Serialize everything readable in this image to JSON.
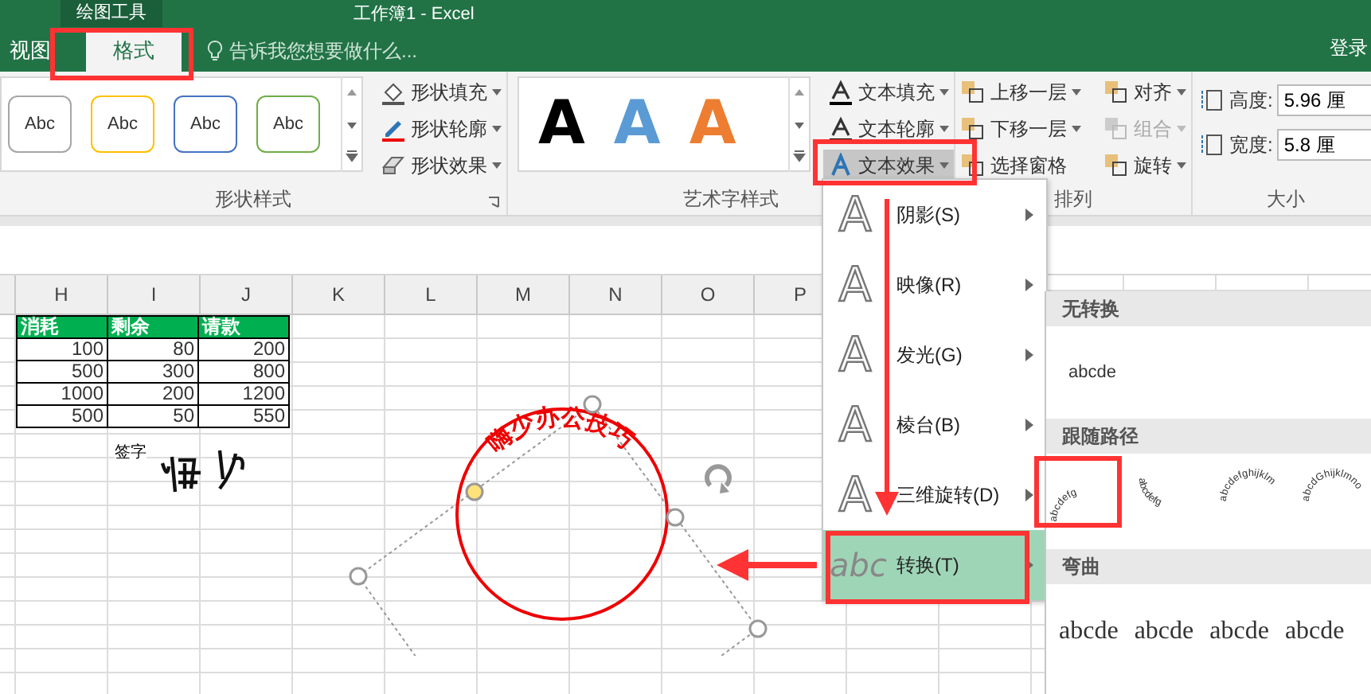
{
  "title_bar": {
    "context_tab": "绘图工具",
    "title": "工作簿1 - Excel"
  },
  "tabs": [
    {
      "label": "视图",
      "selected": false
    },
    {
      "label": "格式",
      "selected": true
    }
  ],
  "tell_me": {
    "placeholder": "告诉我您想要做什么..."
  },
  "sign_in": "登录",
  "ribbon": {
    "shape_styles": {
      "group_label": "形状样式",
      "samples": [
        {
          "label": "Abc",
          "color": "#a6a6a6"
        },
        {
          "label": "Abc",
          "color": "#ffc000"
        },
        {
          "label": "Abc",
          "color": "#4472c4"
        },
        {
          "label": "Abc",
          "color": "#70ad47"
        }
      ],
      "commands": [
        "形状填充",
        "形状轮廓",
        "形状效果"
      ]
    },
    "wordart_styles": {
      "group_label": "艺术字样式",
      "samples": [
        {
          "label": "A",
          "color": "#000000"
        },
        {
          "label": "A",
          "color": "#5b9bd5"
        },
        {
          "label": "A",
          "color": "#ed7d31"
        }
      ],
      "commands": [
        {
          "label": "文本填充",
          "selected": false
        },
        {
          "label": "文本轮廓",
          "selected": false
        },
        {
          "label": "文本效果",
          "selected": true
        }
      ]
    },
    "arrange": {
      "group_label": "排列",
      "commands": [
        {
          "label": "上移一层",
          "disabled": false
        },
        {
          "label": "下移一层",
          "disabled": false
        },
        {
          "label": "选择窗格",
          "disabled": false
        },
        {
          "label": "对齐",
          "disabled": false
        },
        {
          "label": "组合",
          "disabled": true
        },
        {
          "label": "旋转",
          "disabled": false
        }
      ]
    },
    "size": {
      "group_label": "大小",
      "fields": [
        {
          "label": "高度:",
          "value": "5.96 厘"
        },
        {
          "label": "宽度:",
          "value": "5.8 厘"
        }
      ]
    }
  },
  "sheet": {
    "columns": [
      "H",
      "I",
      "J",
      "K",
      "L",
      "M",
      "N",
      "O",
      "P"
    ],
    "table": {
      "header": [
        "消耗",
        "剩余",
        "请款"
      ],
      "rows": [
        [
          "100",
          "80",
          "200"
        ],
        [
          "500",
          "300",
          "800"
        ],
        [
          "1000",
          "200",
          "1200"
        ],
        [
          "500",
          "50",
          "550"
        ]
      ]
    },
    "signature_label": "签字",
    "stamp_text": "嗨少办公技巧"
  },
  "text_effects_menu": {
    "items": [
      {
        "icon": "A",
        "label": "阴影(S)",
        "selected": false
      },
      {
        "icon": "A",
        "label": "映像(R)",
        "selected": false
      },
      {
        "icon": "A",
        "label": "发光(G)",
        "selected": false
      },
      {
        "icon": "A",
        "label": "棱台(B)",
        "selected": false
      },
      {
        "icon": "A",
        "label": "三维旋转(D)",
        "selected": false
      },
      {
        "icon": "abc",
        "label": "转换(T)",
        "selected": true
      }
    ]
  },
  "transform_submenu": {
    "sections": [
      {
        "title": "无转换",
        "kind": "plain",
        "samples": [
          "abcde"
        ]
      },
      {
        "title": "跟随路径",
        "kind": "path",
        "samples": [
          "abcdefg",
          "abcdefg",
          "abcdefghijklm",
          "abcdGhijklmno"
        ]
      },
      {
        "title": "弯曲",
        "kind": "warp",
        "samples": [
          "abcde",
          "abcde",
          "abcde",
          "abcde"
        ]
      }
    ]
  }
}
